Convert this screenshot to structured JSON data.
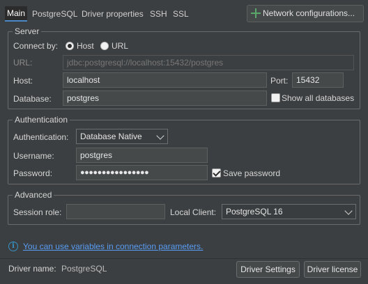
{
  "tabs": [
    "Main",
    "PostgreSQL",
    "Driver properties",
    "SSH",
    "SSL"
  ],
  "network_button": "Network configurations...",
  "server": {
    "legend": "Server",
    "connect_by_label": "Connect by:",
    "radio_host": "Host",
    "radio_url": "URL",
    "url_label": "URL:",
    "url_value": "jdbc:postgresql://localhost:15432/postgres",
    "host_label": "Host:",
    "host_value": "localhost",
    "port_label": "Port:",
    "port_value": "15432",
    "database_label": "Database:",
    "database_value": "postgres",
    "show_all_label": "Show all databases"
  },
  "auth": {
    "legend": "Authentication",
    "auth_label": "Authentication:",
    "auth_value": "Database Native",
    "username_label": "Username:",
    "username_value": "postgres",
    "password_label": "Password:",
    "password_value": "●●●●●●●●●●●●●●●●",
    "save_password_label": "Save password"
  },
  "advanced": {
    "legend": "Advanced",
    "session_role_label": "Session role:",
    "session_role_value": "",
    "local_client_label": "Local Client:",
    "local_client_value": "PostgreSQL 16"
  },
  "info_link": "You can use variables in connection parameters.",
  "footer": {
    "driver_name_label": "Driver name:",
    "driver_name_value": "PostgreSQL",
    "driver_settings": "Driver Settings",
    "driver_license": "Driver license"
  }
}
